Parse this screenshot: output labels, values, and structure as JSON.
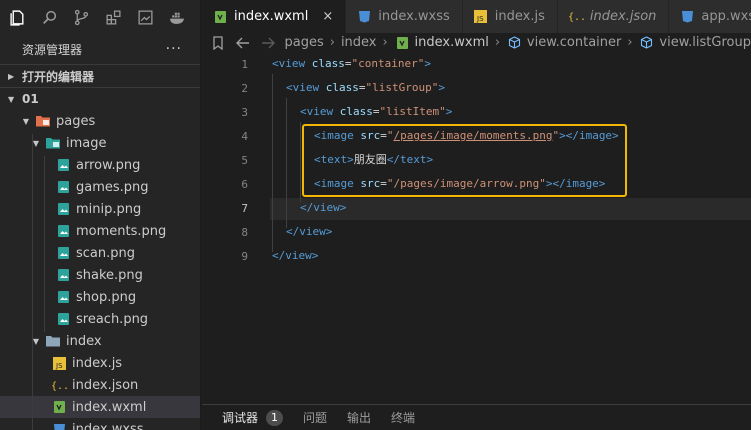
{
  "activity_bar": {
    "icons": [
      "explorer-icon",
      "search-icon",
      "source-control-icon",
      "extensions-icon",
      "image-icon",
      "docker-icon"
    ]
  },
  "explorer": {
    "title": "资源管理器",
    "more": "···",
    "open_editors": "打开的编辑器",
    "project": "01",
    "tree": {
      "pages": "pages",
      "image": "image",
      "images": [
        "arrow.png",
        "games.png",
        "minip.png",
        "moments.png",
        "scan.png",
        "shake.png",
        "shop.png",
        "sreach.png"
      ],
      "index": "index",
      "index_files": [
        "index.js",
        "index.json",
        "index.wxml",
        "index.wxss"
      ]
    }
  },
  "tabs": [
    {
      "label": "index.wxml",
      "icon": "wxml-icon",
      "active": true,
      "close": "×"
    },
    {
      "label": "index.wxss",
      "icon": "css-icon"
    },
    {
      "label": "index.js",
      "icon": "js-icon"
    },
    {
      "label": "index.json",
      "icon": "json-icon",
      "italic": true
    },
    {
      "label": "app.wxss",
      "icon": "css-icon"
    }
  ],
  "breadcrumb": [
    "pages",
    "index",
    "index.wxml",
    "view.container",
    "view.listGroup"
  ],
  "breadcrumb_sep": "›",
  "code": {
    "line_numbers": [
      "1",
      "2",
      "3",
      "4",
      "5",
      "6",
      "7",
      "8",
      "9"
    ],
    "current_line": "7",
    "lines": [
      {
        "num": "1",
        "indent": 0,
        "tokens": [
          {
            "t": "tag",
            "v": "<view"
          },
          {
            "t": "attr",
            "v": " class"
          },
          {
            "t": "eq",
            "v": "="
          },
          {
            "t": "str",
            "v": "\"container\""
          },
          {
            "t": "tag",
            "v": ">"
          }
        ]
      },
      {
        "num": "2",
        "indent": 1,
        "tokens": [
          {
            "t": "tag",
            "v": "<view"
          },
          {
            "t": "attr",
            "v": " class"
          },
          {
            "t": "eq",
            "v": "="
          },
          {
            "t": "str",
            "v": "\"listGroup\""
          },
          {
            "t": "tag",
            "v": ">"
          }
        ]
      },
      {
        "num": "3",
        "indent": 2,
        "tokens": [
          {
            "t": "tag",
            "v": "<view"
          },
          {
            "t": "attr",
            "v": " class"
          },
          {
            "t": "eq",
            "v": "="
          },
          {
            "t": "str",
            "v": "\"listItem\""
          },
          {
            "t": "tag",
            "v": ">"
          }
        ]
      },
      {
        "num": "4",
        "indent": 3,
        "tokens": [
          {
            "t": "tag",
            "v": "<image"
          },
          {
            "t": "attr",
            "v": " src"
          },
          {
            "t": "eq",
            "v": "="
          },
          {
            "t": "str",
            "v": "\""
          },
          {
            "t": "link",
            "v": "/pages/image/moments.png"
          },
          {
            "t": "str",
            "v": "\""
          },
          {
            "t": "tag",
            "v": "></image>"
          }
        ]
      },
      {
        "num": "5",
        "indent": 3,
        "tokens": [
          {
            "t": "tag",
            "v": "<text>"
          },
          {
            "t": "txt",
            "v": "朋友圈"
          },
          {
            "t": "tag",
            "v": "</text>"
          }
        ]
      },
      {
        "num": "6",
        "indent": 3,
        "tokens": [
          {
            "t": "tag",
            "v": "<image"
          },
          {
            "t": "attr",
            "v": " src"
          },
          {
            "t": "eq",
            "v": "="
          },
          {
            "t": "str",
            "v": "\"/pages/image/arrow.png\""
          },
          {
            "t": "tag",
            "v": "></image>"
          }
        ]
      },
      {
        "num": "7",
        "indent": 2,
        "tokens": [
          {
            "t": "tag",
            "v": "</view>"
          }
        ]
      },
      {
        "num": "8",
        "indent": 1,
        "tokens": [
          {
            "t": "tag",
            "v": "</view>"
          }
        ]
      },
      {
        "num": "9",
        "indent": 0,
        "tokens": [
          {
            "t": "tag",
            "v": "</view>"
          }
        ]
      }
    ]
  },
  "panel": {
    "tabs": [
      "调试器",
      "问题",
      "输出",
      "终端"
    ],
    "badge": "1"
  },
  "colors": {
    "highlight": "#f2b705",
    "tag": "#569cd6",
    "attr": "#9cdcfe",
    "string": "#ce9178"
  }
}
